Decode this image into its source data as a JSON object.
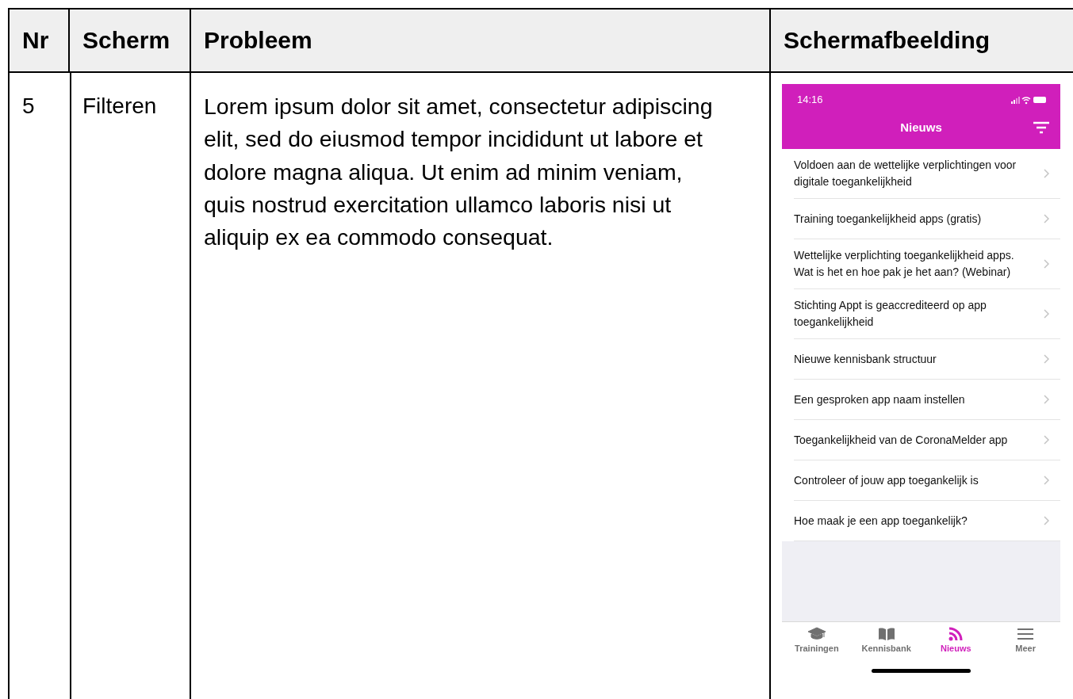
{
  "table": {
    "columns": [
      "Nr",
      "Scherm",
      "Probleem",
      "Schermafbeelding"
    ],
    "rows": [
      {
        "nr": "5",
        "screen": "Filteren",
        "problem": "Lorem ipsum dolor sit amet, consectetur adipiscing elit, sed do eiusmod tempor incididunt ut labore et dolore magna aliqua. Ut enim ad minim veniam, quis nostrud exercitation ullamco laboris nisi ut aliquip ex ea commodo consequat.",
        "screenshot": {
          "status_time": "14:16",
          "title": "Nieuws",
          "items": [
            "Voldoen aan de wettelijke verplichtingen voor digitale toegankelijkheid",
            "Training toegankelijkheid apps (gratis)",
            "Wettelijke verplichting toegankelijkheid apps. Wat is het en hoe pak je het aan? (Webinar)",
            "Stichting Appt is geaccrediteerd op app toegankelijkheid",
            "Nieuwe kennisbank structuur",
            "Een gesproken app naam instellen",
            "Toegankelijkheid van de CoronaMelder app",
            "Controleer of jouw app toegankelijk is",
            "Hoe maak je een app toegankelijk?"
          ],
          "tabs": [
            {
              "label": "Trainingen",
              "kind": "cap",
              "selected": false
            },
            {
              "label": "Kennisbank",
              "kind": "book",
              "selected": false
            },
            {
              "label": "Nieuws",
              "kind": "feed",
              "selected": true
            },
            {
              "label": "Meer",
              "kind": "menu",
              "selected": false
            }
          ]
        }
      }
    ]
  }
}
